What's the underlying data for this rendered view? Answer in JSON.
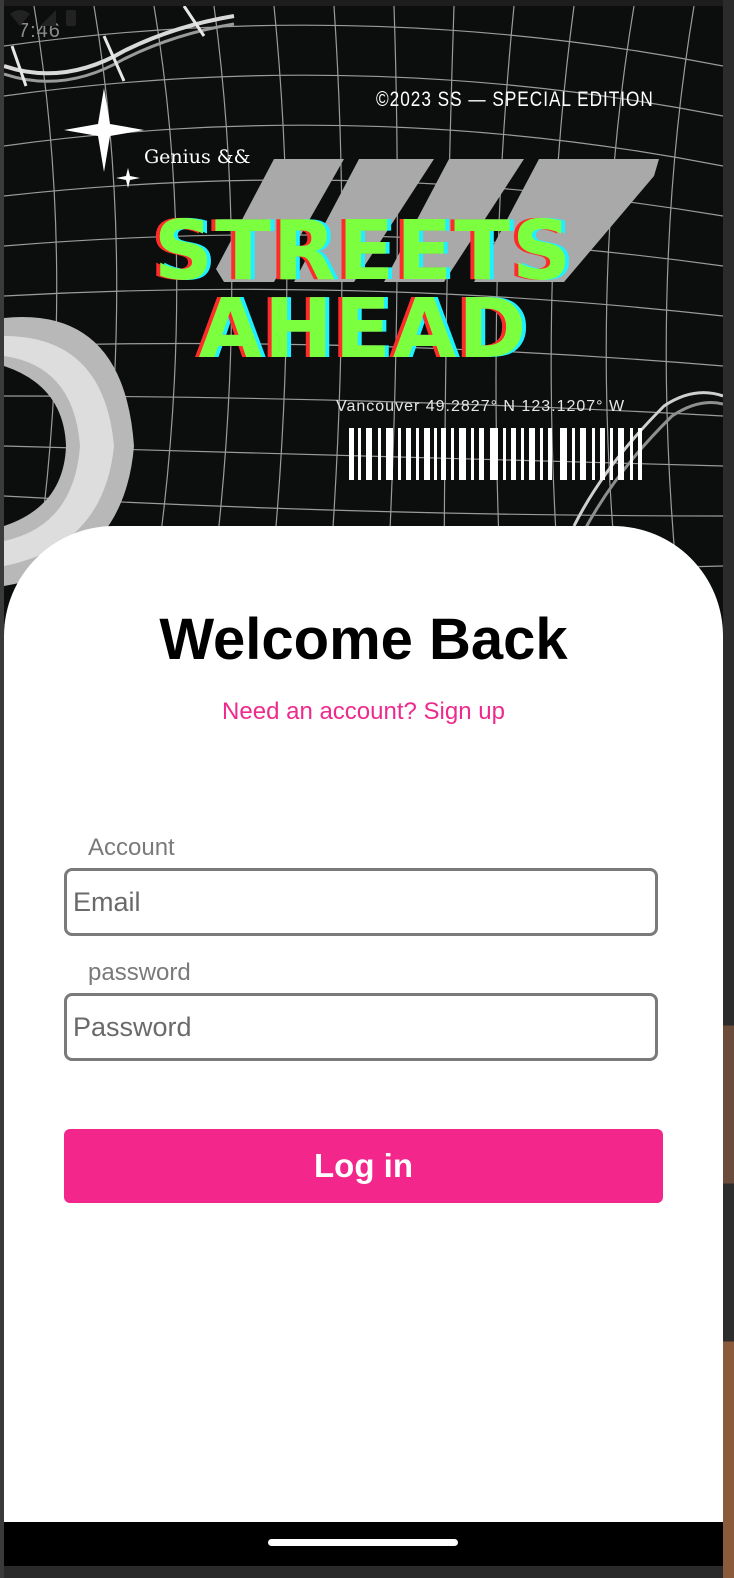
{
  "status_bar": {
    "time": "7:46"
  },
  "hero": {
    "copyright": "©2023 SS — SPECIAL EDITION",
    "tagline": "Genius &&",
    "title_line1": "STREETS",
    "title_line2": "AHEAD",
    "coordinates": "Vancouver 49.2827° N 123.1207° W",
    "accent_green": "#7cff3f"
  },
  "login": {
    "heading": "Welcome Back",
    "signup_link": "Need an account? Sign up",
    "account_label": "Account",
    "email_placeholder": "Email",
    "password_label": "password",
    "password_placeholder": "Password",
    "login_button": "Log in",
    "accent_color": "#f2268b"
  }
}
